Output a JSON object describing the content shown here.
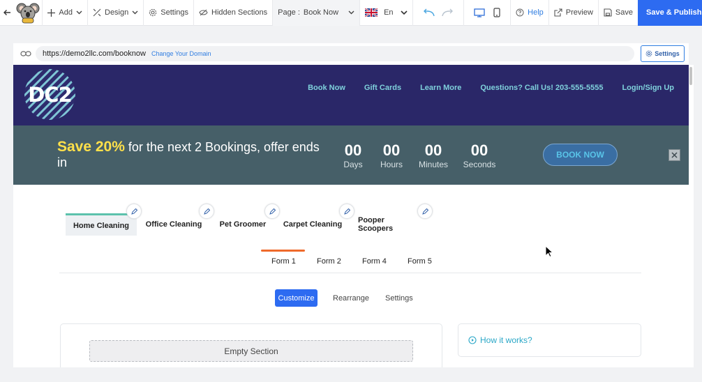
{
  "toolbar": {
    "add_label": "Add",
    "design_label": "Design",
    "settings_label": "Settings",
    "hidden_sections_label": "Hidden Sections",
    "page_prefix": "Page :",
    "page_value": "Book Now",
    "language_value": "En",
    "help_label": "Help",
    "preview_label": "Preview",
    "save_label": "Save",
    "publish_label": "Save & Publish"
  },
  "urlbar": {
    "url": "https://demo2llc.com/booknow",
    "change_domain_label": "Change Your Domain",
    "settings_label": "Settings"
  },
  "site": {
    "logo_text": "DC2",
    "nav": [
      "Book Now",
      "Gift Cards",
      "Learn More",
      "Questions? Call Us! 203-555-5555",
      "Login/Sign Up"
    ],
    "promo": {
      "highlight": "Save 20%",
      "text": " for the next 2 Bookings, offer ends in",
      "countdown": [
        {
          "value": "00",
          "label": "Days"
        },
        {
          "value": "00",
          "label": "Hours"
        },
        {
          "value": "00",
          "label": "Minutes"
        },
        {
          "value": "00",
          "label": "Seconds"
        }
      ],
      "button_label": "BOOK NOW"
    },
    "service_tabs": [
      "Home Cleaning",
      "Office Cleaning",
      "Pet Groomer",
      "Carpet Cleaning",
      "Pooper Scoopers"
    ],
    "form_tabs": [
      "Form 1",
      "Form 2",
      "Form 4",
      "Form 5"
    ],
    "mode_buttons": {
      "customize": "Customize",
      "rearrange": "Rearrange",
      "settings": "Settings"
    },
    "empty_section_label": "Empty Section",
    "how_it_works_label": "How it works?"
  },
  "colors": {
    "accent": "#2d6bf1",
    "hero": "#2a2768",
    "promo": "#465f68",
    "promo_highlight": "#ffe04a",
    "nav_text": "#7fd1dc",
    "active_tab_bar": "#5cc2ac",
    "form_underline": "#ef6a2b"
  }
}
